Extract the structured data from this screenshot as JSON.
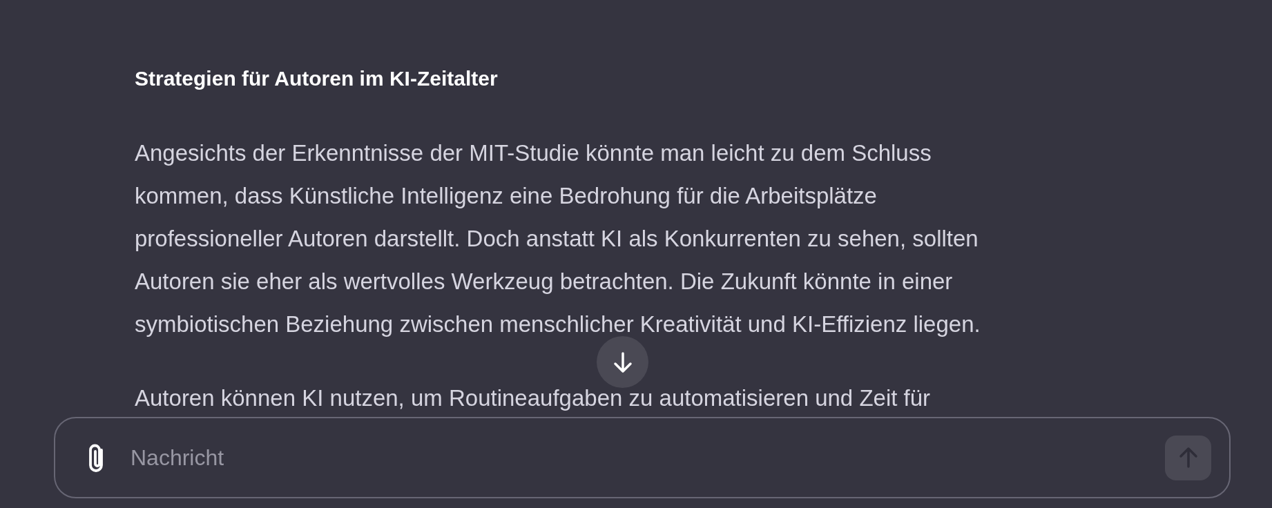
{
  "message": {
    "heading": "Strategien für Autoren im KI-Zeitalter",
    "paragraphs": [
      "Angesichts der Erkenntnisse der MIT-Studie könnte man leicht zu dem Schluss kommen, dass Künstliche Intelligenz eine Bedrohung für die Arbeitsplätze professioneller Autoren darstellt. Doch anstatt KI als Konkurrenten zu sehen, sollten Autoren sie eher als wertvolles Werkzeug betrachten. Die Zukunft könnte in einer symbiotischen Beziehung zwischen menschlicher Kreativität und KI-Effizienz liegen.",
      "Autoren können KI nutzen, um Routineaufgaben zu automatisieren und Zeit für"
    ]
  },
  "composer": {
    "placeholder": "Nachricht",
    "send_disabled": true
  }
}
